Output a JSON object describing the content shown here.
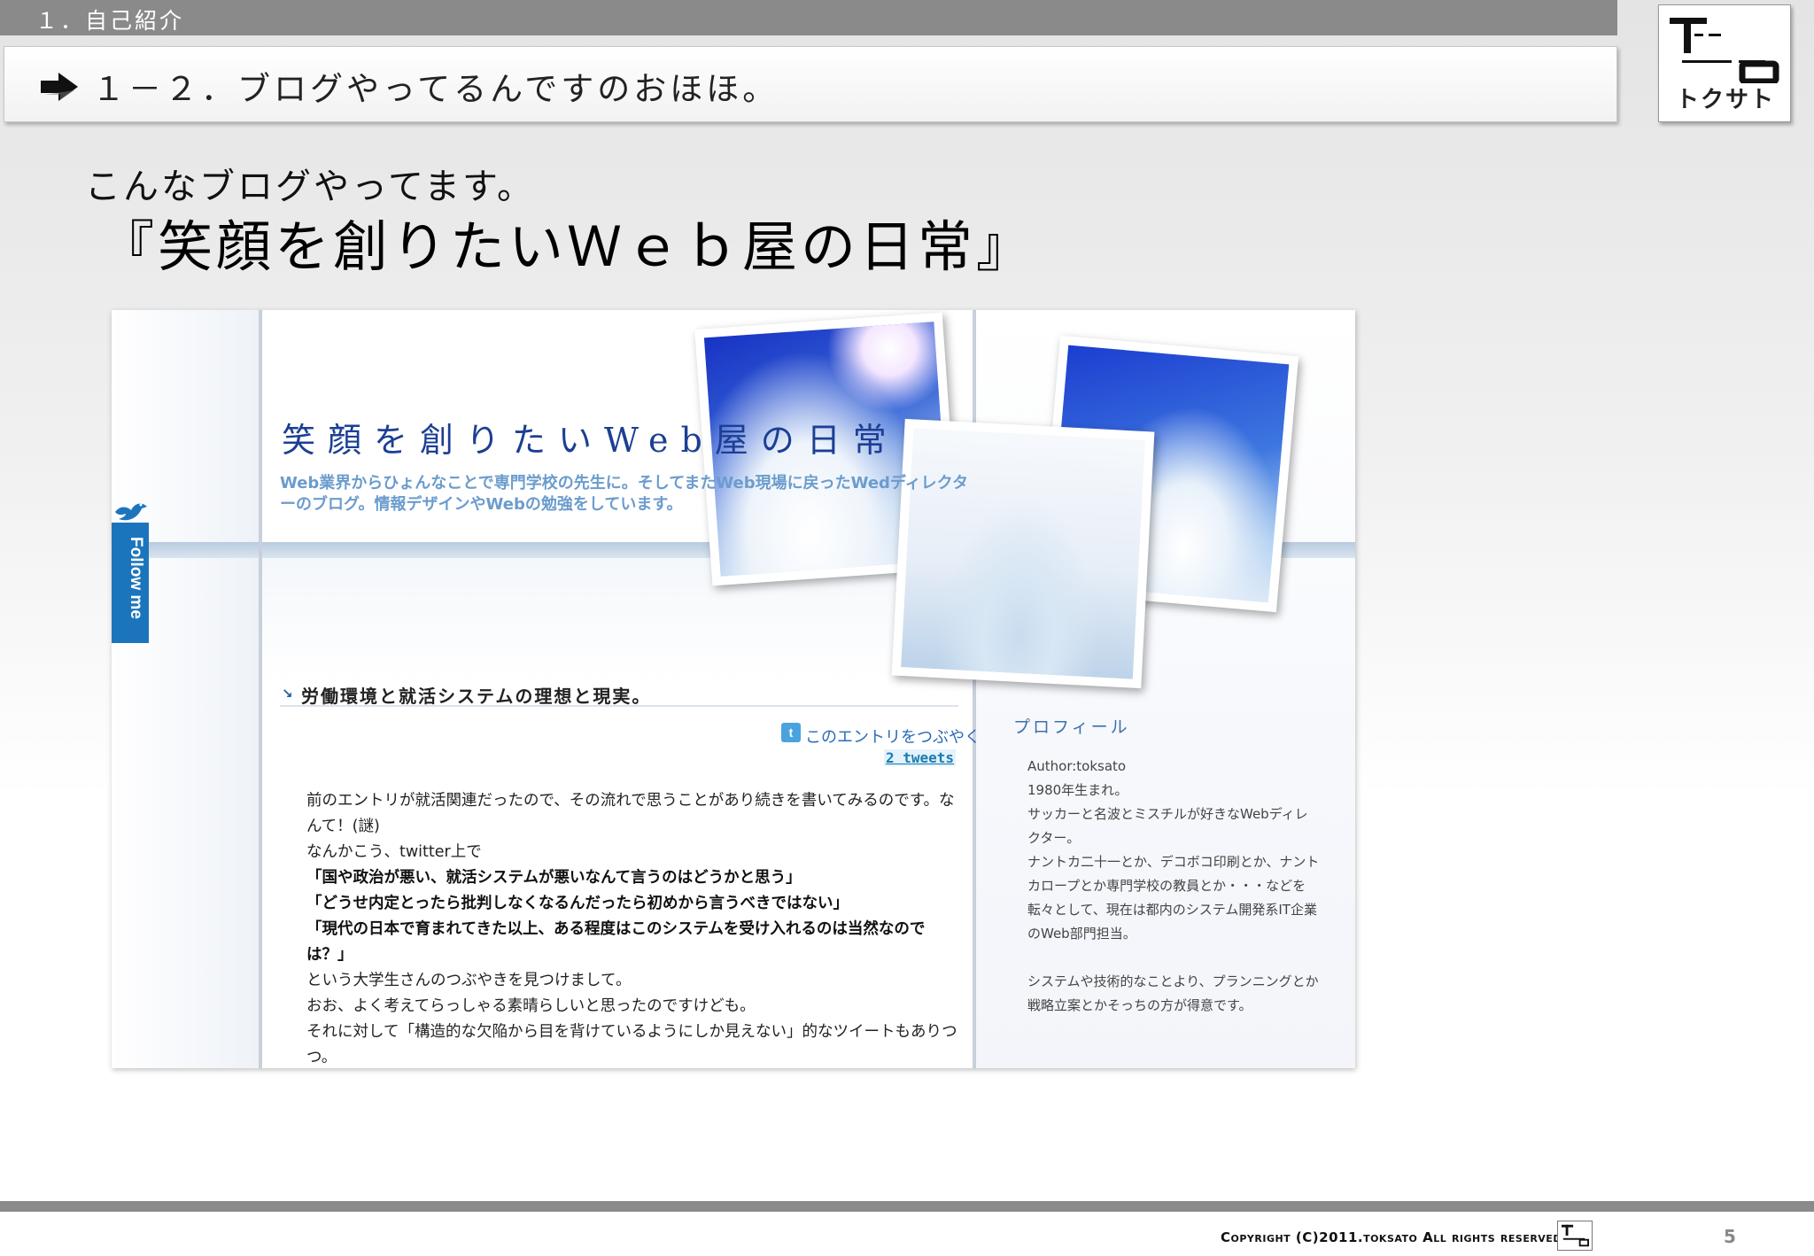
{
  "header": {
    "section": "１．自己紹介",
    "subsection": "１－２．ブログやってるんですのおほほ。",
    "logo_text": "トクサト"
  },
  "intro": {
    "lead": "こんなブログやってます。",
    "blog_name": "『笑顔を創りたいＷｅｂ屋の日常』"
  },
  "blog": {
    "title": "笑顔を創りたいWeb屋の日常",
    "description": "Web業界からひょんなことで専門学校の先生に。そしてまたWeb現場に戻ったWedディレクターのブログ。情報デザインやWebの勉強をしています。",
    "follow": "Follow me",
    "entry_title": "労働環境と就活システムの理想と現実。",
    "tweet_link": "このエントリをつぶやく",
    "tweet_count": "2 tweets",
    "body": [
      {
        "text": "前のエントリが就活関連だったので、その流れで思うことがあり続きを書いてみるのです。なんて！(謎)",
        "bold": false
      },
      {
        "text": "なんかこう、twitter上で",
        "bold": false
      },
      {
        "text": "「国や政治が悪い、就活システムが悪いなんて言うのはどうかと思う」",
        "bold": true
      },
      {
        "text": "「どうせ内定とったら批判しなくなるんだったら初めから言うべきではない」",
        "bold": true
      },
      {
        "text": "「現代の日本で育まれてきた以上、ある程度はこのシステムを受け入れるのは当然なのでは？」",
        "bold": true
      },
      {
        "text": "という大学生さんのつぶやきを見つけまして。",
        "bold": false
      },
      {
        "text": "おお、よく考えてらっしゃる素晴らしいと思ったのですけども。",
        "bold": false
      },
      {
        "text": "それに対して「構造的な欠陥から目を背けているようにしか見えない」的なツイートもありつつ。",
        "bold": false
      }
    ],
    "profile_title": "プロフィール",
    "profile_lines": [
      "Author:toksato",
      "1980年生まれ。",
      "サッカーと名波とミスチルが好きなWebディレクター。",
      "ナントカ二十一とか、デコボコ印刷とか、ナントカロープとか専門学校の教員とか・・・などを転々として、現在は都内のシステム開発系IT企業のWeb部門担当。",
      "",
      "システムや技術的なことより、プランニングとか戦略立案とかそっちの方が得意です。"
    ]
  },
  "footer": {
    "copyright": "Copyright (C)2011.toksato All rights reserved.",
    "page": "5"
  }
}
